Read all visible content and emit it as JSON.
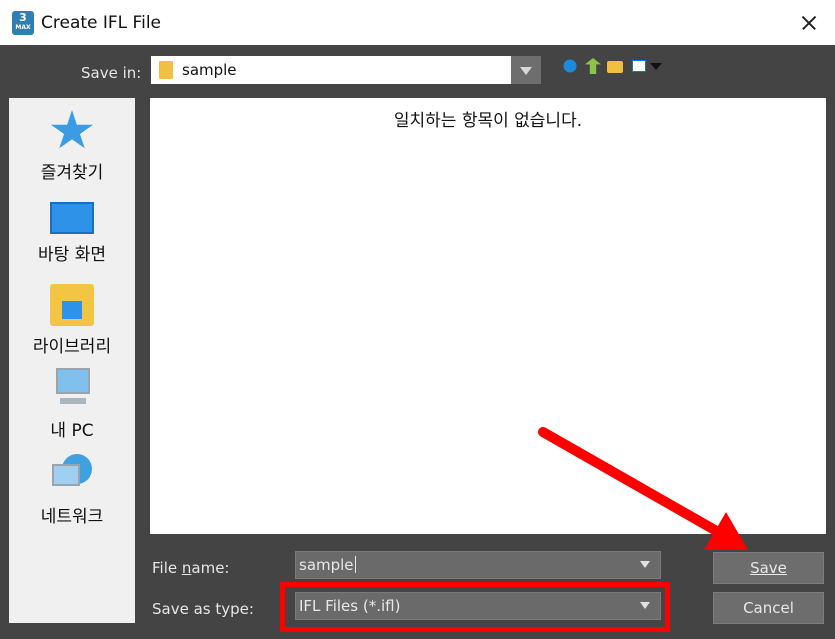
{
  "window": {
    "title": "Create IFL File",
    "app_icon_text": "3",
    "app_icon_sub": "MAX"
  },
  "save_in": {
    "label": "Save in:",
    "value": "sample"
  },
  "places": [
    {
      "label": "즐겨찾기",
      "icon": "favorites-star-icon"
    },
    {
      "label": "바탕 화면",
      "icon": "desktop-icon"
    },
    {
      "label": "라이브러리",
      "icon": "library-folder-icon"
    },
    {
      "label": "내 PC",
      "icon": "this-pc-icon"
    },
    {
      "label": "네트워크",
      "icon": "network-icon"
    }
  ],
  "file_list": {
    "empty_message": "일치하는 항목이 없습니다."
  },
  "file_name": {
    "label": "File name:",
    "value": "sample"
  },
  "save_as_type": {
    "label": "Save as type:",
    "value": "IFL Files (*.ifl)"
  },
  "buttons": {
    "save": "Save",
    "cancel": "Cancel"
  },
  "colors": {
    "dialog_bg": "#444444",
    "annotation_red": "#ff0000"
  }
}
